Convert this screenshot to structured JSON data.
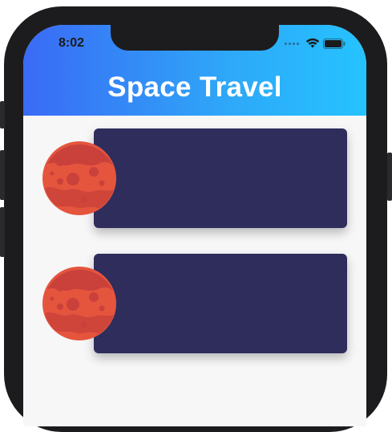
{
  "status_bar": {
    "time": "8:02",
    "icons": [
      "signal-dots-icon",
      "wifi-icon",
      "battery-icon"
    ]
  },
  "header": {
    "title": "Space Travel",
    "gradient": [
      "#3a6af5",
      "#25c3ff"
    ]
  },
  "list": {
    "items": [
      {
        "planet_icon": "mars-planet-icon",
        "card_color": "#2e2d5c"
      },
      {
        "planet_icon": "mars-planet-icon",
        "card_color": "#2e2d5c"
      }
    ]
  },
  "colors": {
    "card": "#2e2d5c",
    "planet": "#e5553e",
    "background": "#f7f7f8"
  }
}
